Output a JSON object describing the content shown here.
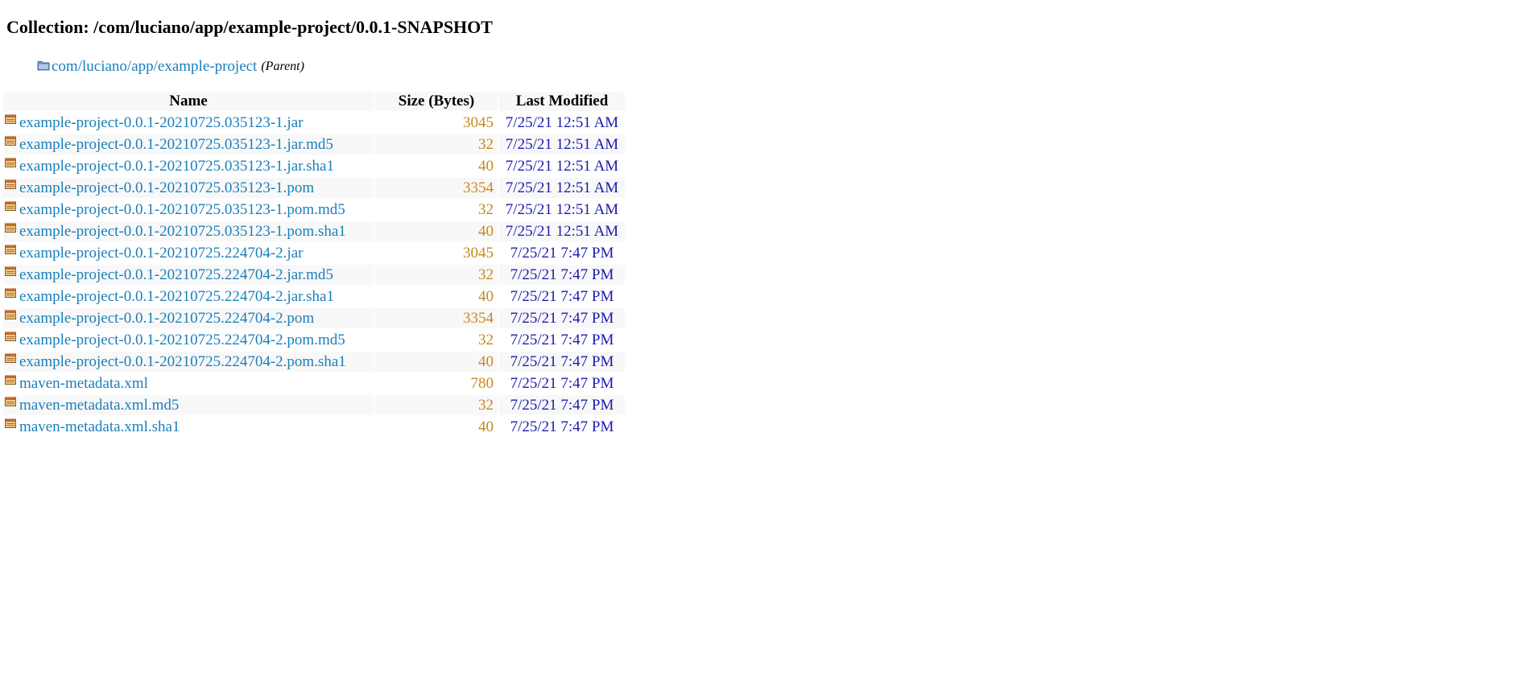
{
  "header": {
    "title": "Collection: /com/luciano/app/example-project/0.0.1-SNAPSHOT"
  },
  "parent": {
    "link_text": "com/luciano/app/example-project",
    "note": "(Parent)",
    "icon": "folder-icon"
  },
  "table": {
    "columns": {
      "name": "Name",
      "size": "Size (Bytes)",
      "modified": "Last Modified"
    },
    "file_icon": "file-icon",
    "rows": [
      {
        "name": "example-project-0.0.1-20210725.035123-1.jar",
        "size": "3045",
        "modified": "7/25/21 12:51 AM"
      },
      {
        "name": "example-project-0.0.1-20210725.035123-1.jar.md5",
        "size": "32",
        "modified": "7/25/21 12:51 AM"
      },
      {
        "name": "example-project-0.0.1-20210725.035123-1.jar.sha1",
        "size": "40",
        "modified": "7/25/21 12:51 AM"
      },
      {
        "name": "example-project-0.0.1-20210725.035123-1.pom",
        "size": "3354",
        "modified": "7/25/21 12:51 AM"
      },
      {
        "name": "example-project-0.0.1-20210725.035123-1.pom.md5",
        "size": "32",
        "modified": "7/25/21 12:51 AM"
      },
      {
        "name": "example-project-0.0.1-20210725.035123-1.pom.sha1",
        "size": "40",
        "modified": "7/25/21 12:51 AM"
      },
      {
        "name": "example-project-0.0.1-20210725.224704-2.jar",
        "size": "3045",
        "modified": "7/25/21 7:47 PM"
      },
      {
        "name": "example-project-0.0.1-20210725.224704-2.jar.md5",
        "size": "32",
        "modified": "7/25/21 7:47 PM"
      },
      {
        "name": "example-project-0.0.1-20210725.224704-2.jar.sha1",
        "size": "40",
        "modified": "7/25/21 7:47 PM"
      },
      {
        "name": "example-project-0.0.1-20210725.224704-2.pom",
        "size": "3354",
        "modified": "7/25/21 7:47 PM"
      },
      {
        "name": "example-project-0.0.1-20210725.224704-2.pom.md5",
        "size": "32",
        "modified": "7/25/21 7:47 PM"
      },
      {
        "name": "example-project-0.0.1-20210725.224704-2.pom.sha1",
        "size": "40",
        "modified": "7/25/21 7:47 PM"
      },
      {
        "name": "maven-metadata.xml",
        "size": "780",
        "modified": "7/25/21 7:47 PM"
      },
      {
        "name": "maven-metadata.xml.md5",
        "size": "32",
        "modified": "7/25/21 7:47 PM"
      },
      {
        "name": "maven-metadata.xml.sha1",
        "size": "40",
        "modified": "7/25/21 7:47 PM"
      }
    ]
  },
  "colors": {
    "link": "#1a7fbb",
    "size": "#c8881c",
    "date": "#1a1ab0",
    "row_alt": "#f8f8f8"
  }
}
